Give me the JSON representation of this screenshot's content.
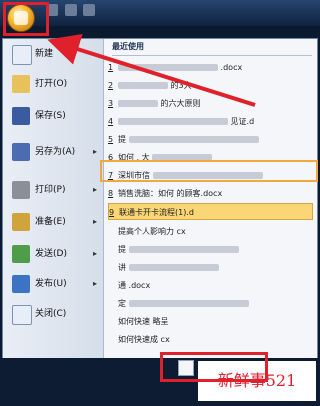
{
  "left_menu": [
    {
      "label": "新建"
    },
    {
      "label": "打开(O)"
    },
    {
      "label": "保存(S)"
    },
    {
      "label": "另存为(A)",
      "arrow": "▸"
    },
    {
      "label": "打印(P)",
      "arrow": "▸"
    },
    {
      "label": "准备(E)",
      "arrow": "▸"
    },
    {
      "label": "发送(D)",
      "arrow": "▸"
    },
    {
      "label": "发布(U)",
      "arrow": "▸"
    },
    {
      "label": "关闭(C)"
    }
  ],
  "right_header": "最近使用",
  "recent_docs": [
    {
      "num": "1",
      "text": ".docx"
    },
    {
      "num": "2",
      "text": "的3大"
    },
    {
      "num": "3",
      "text": "的六大原则"
    },
    {
      "num": "4",
      "text": "见证.d"
    },
    {
      "num": "5",
      "text": "提"
    },
    {
      "num": "6",
      "text": "如何 , 大"
    },
    {
      "num": "7",
      "text": "深圳市信"
    },
    {
      "num": "8",
      "text": "销售洗脑：如何 的顾客.docx"
    },
    {
      "num": "9",
      "text": "联通卡开卡流程(1).d"
    },
    {
      "num": "",
      "text": "提高个人影响力 cx"
    },
    {
      "num": "",
      "text": "提"
    },
    {
      "num": "",
      "text": "讲"
    },
    {
      "num": "",
      "text": "通 .docx"
    },
    {
      "num": "",
      "text": "定 "
    },
    {
      "num": "",
      "text": "如何快速 略呈"
    },
    {
      "num": "",
      "text": "如何快速成 cx"
    }
  ],
  "watermark": "新鲜事521",
  "colors": {
    "highlight": "#e0202a",
    "selected_bg": "#fbd676",
    "menu_bg": "#dfe7f2"
  },
  "icons": {
    "office_button": "office-logo",
    "left": [
      "new-doc-icon",
      "open-folder-icon",
      "save-floppy-icon",
      "save-as-icon",
      "print-icon",
      "prepare-icon",
      "send-icon",
      "publish-icon",
      "close-icon"
    ]
  }
}
